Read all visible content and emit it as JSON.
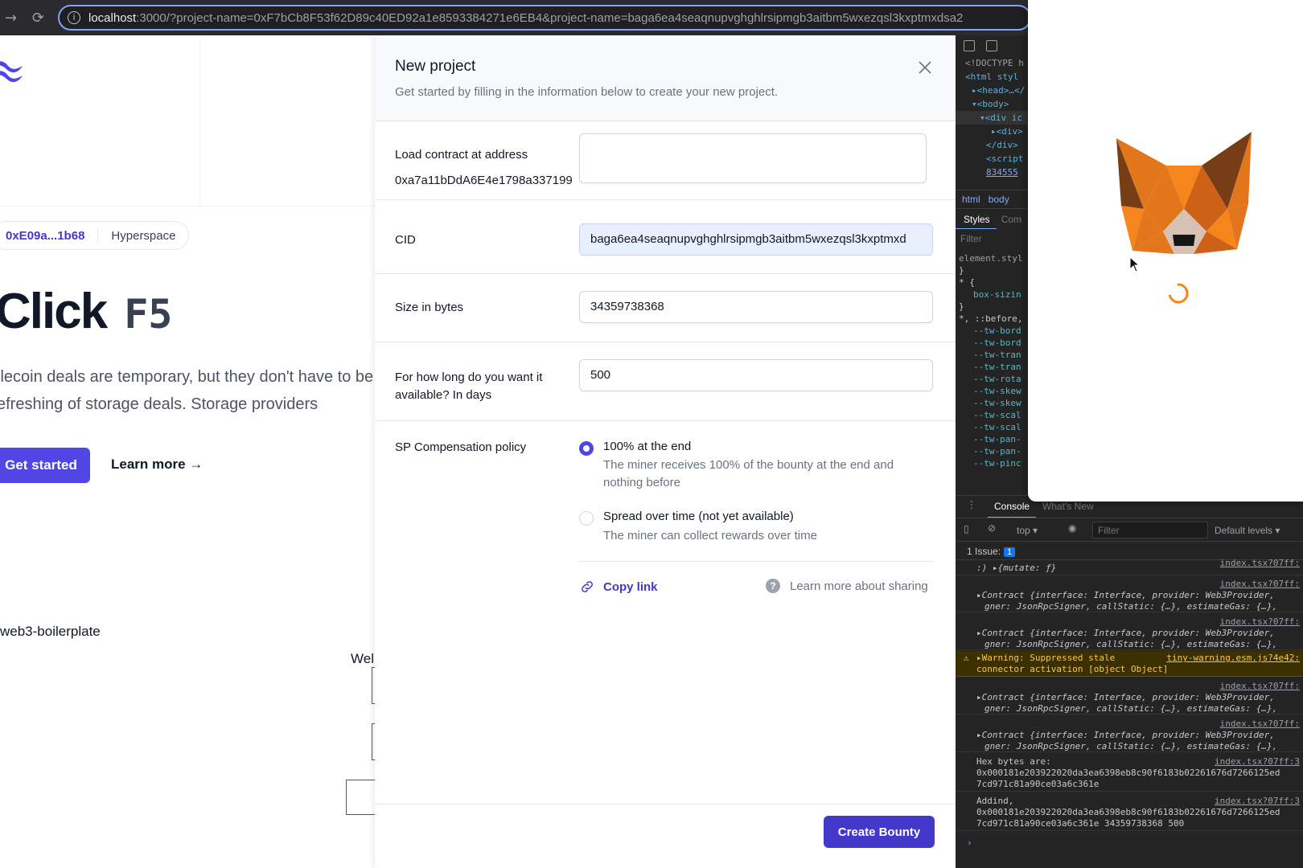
{
  "browser": {
    "url_host": "localhost",
    "url_rest": ":3000/?project-name=0xF7bCb8F53f62D89c40ED92a1e8593384271e6EB4&project-name=baga6ea4seaqnupvghghlrsipmgb3aitbm5wxezqsl3kxptmxdsa2"
  },
  "background_page": {
    "wallet_address": "0xE09a...1b68",
    "network": "Hyperspace",
    "hero_title": "Click",
    "hero_key": "F5",
    "lede_line1": "ilecoin deals are temporary, but they don't have to be.",
    "lede_line2": "efreshing of storage deals. Storage providers",
    "get_started": "Get started",
    "learn_more": "Learn more →",
    "boilerplate": "web3-boilerplate",
    "welcome": "Wel"
  },
  "modal": {
    "title": "New project",
    "subtitle": "Get started by filling in the information below to create your new project.",
    "contract_label": "Load contract at address",
    "contract_address": "0xa7a11bDdA6E4e1798a337199",
    "contract_value": "",
    "cid_label": "CID",
    "cid_value": "baga6ea4seaqnupvghghlrsipmgb3aitbm5wxezqsl3kxptmxd",
    "size_label": "Size in bytes",
    "size_value": "34359738368",
    "duration_label": "For how long do you want it available? In days",
    "duration_value": "500",
    "policy_label": "SP Compensation policy",
    "policy_options": [
      {
        "title": "100% at the end",
        "desc": "The miner receives 100% of the bounty at the end and nothing before",
        "selected": true
      },
      {
        "title": "Spread over time (not yet available)",
        "desc": "The miner can collect rewards over time",
        "selected": false
      }
    ],
    "copy_link": "Copy link",
    "learn_sharing": "Learn more about sharing",
    "create_button": "Create Bounty",
    "accent_color": "#4338ca"
  },
  "devtools": {
    "elements": [
      "<!DOCTYPE h",
      "<html styl",
      "▸<head>…</",
      "▾<body>",
      "▾<div ic",
      "▸<div>",
      "</div>",
      "<script",
      "834555"
    ],
    "breadcrumb_html": "html",
    "breadcrumb_body": "body",
    "tab_styles": "Styles",
    "tab_computed": "Com",
    "filter": "Filter",
    "styles_lines": [
      "element.styl",
      "}",
      "* {",
      "box-sizin",
      "}",
      "*, ::before,",
      "--tw-bord",
      "--tw-bord",
      "--tw-tran",
      "--tw-tran",
      "--tw-rota",
      "--tw-skew",
      "--tw-skew",
      "--tw-scal",
      "--tw-scal",
      "--tw-pan-",
      "--tw-pan-",
      "--tw-pinc"
    ],
    "console_tab": "Console",
    "whats_new_tab": "What's New",
    "context": "top ▾",
    "console_filter": "Filter",
    "levels": "Default levels ▾",
    "issues_label": "1 Issue:",
    "issues_count": "1",
    "logs": [
      {
        "src": "index.tsx?07ff:",
        "l1": ":) ▸{mutate: ƒ}",
        "l2": ""
      },
      {
        "src": "index.tsx?07ff:",
        "l1": "▸Contract {interface: Interface, provider: Web3Provider,",
        "l2": "gner: JsonRpcSigner, callStatic: {…}, estimateGas: {…},"
      },
      {
        "src": "index.tsx?07ff:",
        "l1": "▸Contract {interface: Interface, provider: Web3Provider,",
        "l2": "gner: JsonRpcSigner, callStatic: {…}, estimateGas: {…},"
      },
      {
        "src": "tiny-warning.esm.js?4e42:",
        "l1": "▸Warning: Suppressed stale",
        "l2": "connector activation [object Object]"
      },
      {
        "src": "index.tsx?07ff:",
        "l1": "▸Contract {interface: Interface, provider: Web3Provider,",
        "l2": "gner: JsonRpcSigner, callStatic: {…}, estimateGas: {…},"
      },
      {
        "src": "index.tsx?07ff:",
        "l1": "▸Contract {interface: Interface, provider: Web3Provider,",
        "l2": "gner: JsonRpcSigner, callStatic: {…}, estimateGas: {…},"
      },
      {
        "src": "index.tsx?07ff:3",
        "l1": "Hex bytes are:",
        "l2": "0x000181e203922020da3ea6398eb8c90f6183b02261676d7266125ed",
        "l3": "7cd971c81a90ce03a6c361e"
      },
      {
        "src": "index.tsx?07ff:3",
        "l1": "Addind,",
        "l2": "0x000181e203922020da3ea6398eb8c90f6183b02261676d7266125ed",
        "l3": "7cd971c81a90ce03a6c361e 34359738368 500"
      }
    ],
    "prompt": "›"
  }
}
